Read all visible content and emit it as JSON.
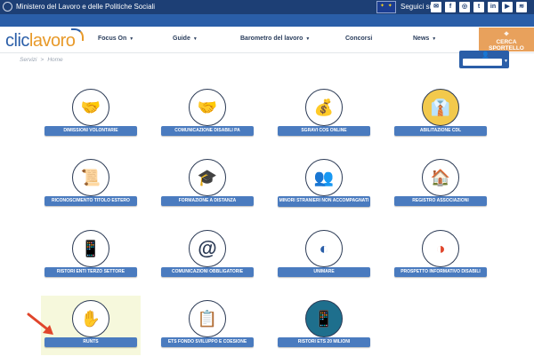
{
  "topbar": {
    "ministry": "Ministero del Lavoro e delle Politiche Sociali",
    "follow": "Seguici su",
    "social": [
      "✉",
      "f",
      "◎",
      "t",
      "in",
      "▶",
      "≋"
    ]
  },
  "header": {
    "logo_part1": "clic",
    "logo_part2": "lavoro",
    "menu": [
      {
        "label": "Focus On",
        "caret": "▼"
      },
      {
        "label": "Guide",
        "caret": "▼"
      },
      {
        "label": "Barometro del lavoro",
        "caret": "▼"
      },
      {
        "label": "Concorsi",
        "caret": ""
      },
      {
        "label": "News",
        "caret": "▼"
      }
    ],
    "cerca_label": "CERCA SPORTELLO"
  },
  "breadcrumb": {
    "servizi": "Servizi",
    "separator": ">",
    "home": "Home"
  },
  "tiles": [
    {
      "label": "DIMISSIONI VOLONTARIE",
      "icon": "🤝"
    },
    {
      "label": "COMUNICAZIONE DISABILI PA",
      "icon": "🤝"
    },
    {
      "label": "SGRAVI COS ONLINE",
      "icon": "💰"
    },
    {
      "label": "ABILITAZIONE CDL",
      "icon": "👔"
    },
    {
      "label": "RICONOSCIMENTO TITOLO ESTERO",
      "icon": "📜"
    },
    {
      "label": "FORMAZIONE A DISTANZA",
      "icon": "🎓"
    },
    {
      "label": "MINORI STRANIERI NON ACCOMPAGNATI",
      "icon": "👥"
    },
    {
      "label": "REGISTRO ASSOCIAZIONI",
      "icon": "🏠"
    },
    {
      "label": "RISTORI ENTI TERZO SETTORE",
      "icon": "📱"
    },
    {
      "label": "COMUNICAZIONI OBBLIGATORIE",
      "icon": "@"
    },
    {
      "label": "UNIMARE",
      "icon": "◐"
    },
    {
      "label": "PROSPETTO INFORMATIVO DISABILI",
      "icon": "◑"
    },
    {
      "label": "RUNTS",
      "icon": "✋"
    },
    {
      "label": "ETS FONDO SVILUPPO E COESIONE",
      "icon": "📋"
    },
    {
      "label": "RISTORI ETS 20 MILIONI",
      "icon": "📱"
    }
  ],
  "colors": {
    "topbar": "#1d3f75",
    "navbar": "#2a5ea8",
    "label_bg": "#4a7bbf",
    "cerca_bg": "#e8a15c",
    "arrow": "#e0452b"
  }
}
